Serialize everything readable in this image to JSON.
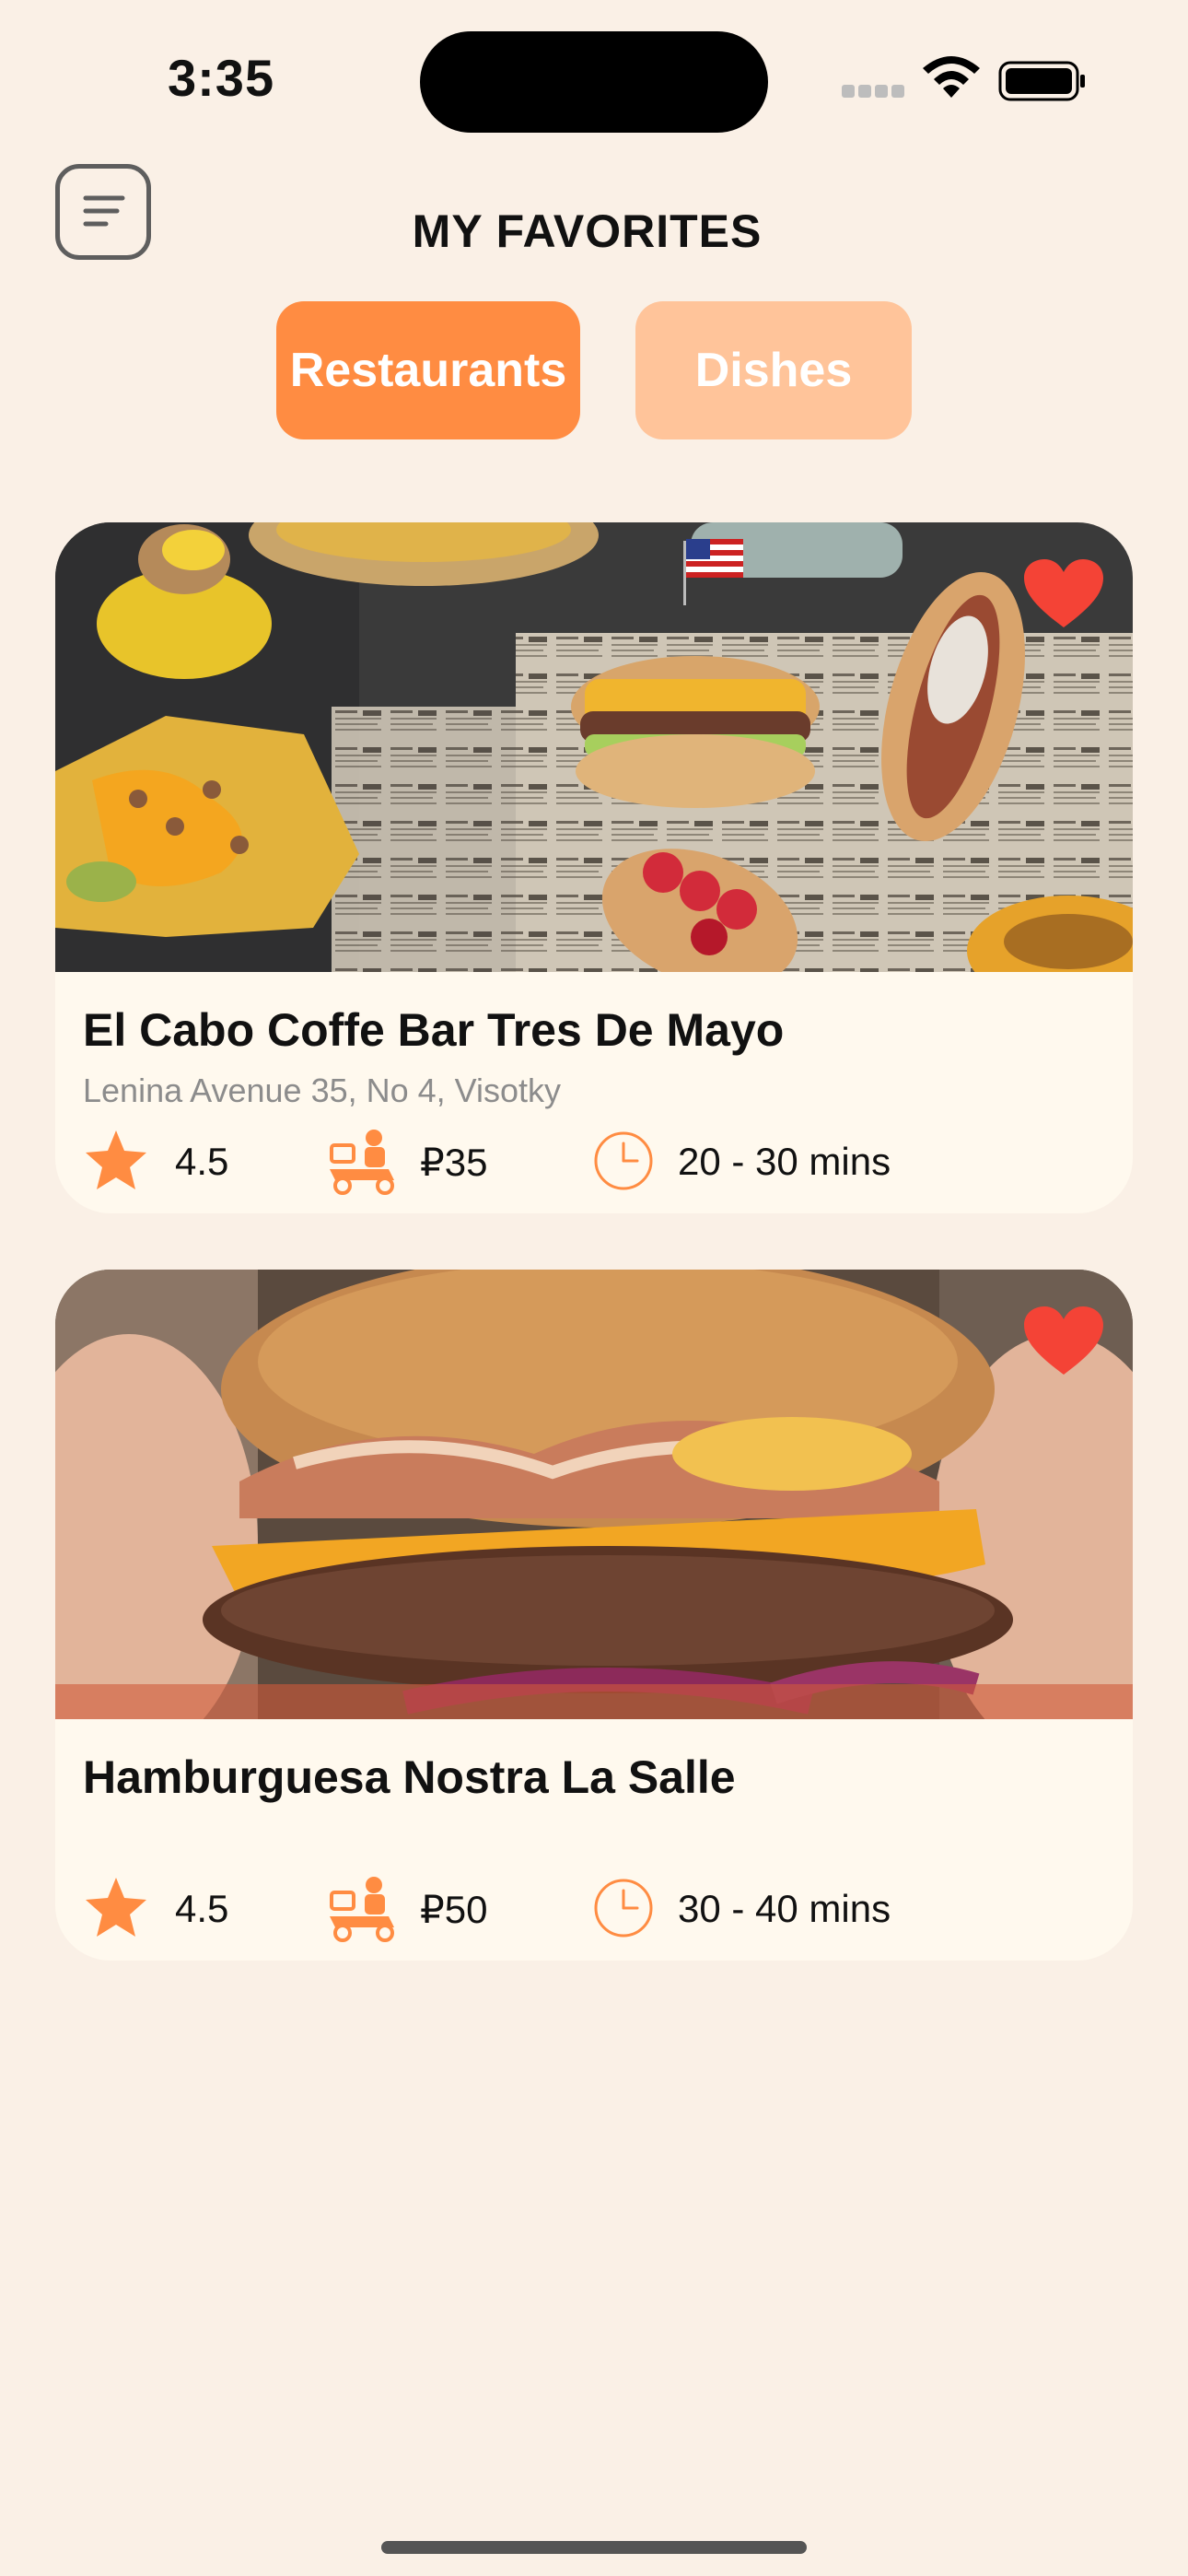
{
  "status_bar": {
    "time": "3:35"
  },
  "header": {
    "title": "MY FAVORITES",
    "menu_icon": "menu-list-icon"
  },
  "tabs": [
    {
      "label": "Restaurants",
      "active": true,
      "color": "#FF8C42"
    },
    {
      "label": "Dishes",
      "active": false,
      "color": "#FFC49A"
    }
  ],
  "colors": {
    "background": "#FAF0E6",
    "card": "#FFF9EE",
    "accent": "#FF8C42",
    "heart": "#F44336"
  },
  "restaurants": [
    {
      "name": "El Cabo Coffe Bar Tres De Mayo",
      "address": "Lenina Avenue 35, No 4, Visotky",
      "rating": "4.5",
      "delivery_fee": "₽35",
      "delivery_time": "20 - 30 mins",
      "favorite": true,
      "image": "mexican-food-spread-photo"
    },
    {
      "name": "Hamburguesa Nostra La Salle",
      "address": "",
      "rating": "4.5",
      "delivery_fee": "₽50",
      "delivery_time": "30 - 40 mins",
      "favorite": true,
      "image": "bacon-cheeseburger-photo"
    }
  ]
}
